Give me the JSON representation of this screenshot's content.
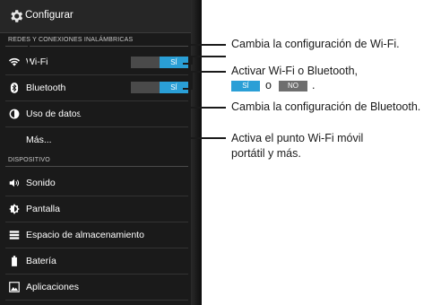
{
  "header": {
    "title": "Configurar",
    "icon": "gear-icon"
  },
  "sections": {
    "wireless": "REDES Y CONEXIONES INALÁMBRICAS",
    "device": "DISPOSITIVO"
  },
  "rows": {
    "wifi": {
      "label": "Wi-Fi",
      "toggle": "SÍ",
      "icon": "wifi-icon"
    },
    "bluetooth": {
      "label": "Bluetooth",
      "toggle": "SÍ",
      "icon": "bluetooth-icon"
    },
    "data_usage": {
      "label": "Uso de datos",
      "icon": "data-usage-icon"
    },
    "more": {
      "label": "Más..."
    },
    "sound": {
      "label": "Sonido",
      "icon": "speaker-icon"
    },
    "display": {
      "label": "Pantalla",
      "icon": "brightness-icon"
    },
    "storage": {
      "label": "Espacio de almacenamiento",
      "icon": "storage-icon"
    },
    "battery": {
      "label": "Batería",
      "icon": "battery-icon"
    },
    "apps": {
      "label": "Aplicaciones",
      "icon": "apps-icon"
    }
  },
  "callouts": {
    "wifi": "Cambia la configuración de Wi-Fi.",
    "toggle_line1": "Activar Wi-Fi o Bluetooth,",
    "legend_on": "SÍ",
    "legend_or": "o",
    "legend_off": "NO",
    "legend_end": ".",
    "bluetooth": "Cambia la configuración de Bluetooth.",
    "more_line1": "Activa el punto Wi-Fi móvil",
    "more_line2": "portátil y más."
  },
  "colors": {
    "accent": "#2a9fd6",
    "off": "#4a4a4a",
    "panel": "#1a1a1a"
  }
}
